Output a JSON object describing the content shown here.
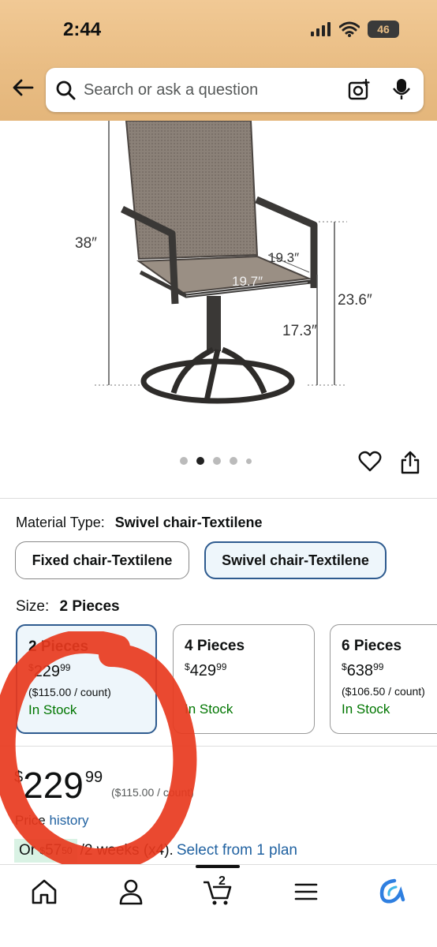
{
  "status_bar": {
    "time": "2:44",
    "battery": "46"
  },
  "search": {
    "placeholder": "Search or ask a question"
  },
  "product_image": {
    "dimensions": [
      "38″",
      "19.3″",
      "19.7″",
      "23.6″",
      "17.3″"
    ],
    "carousel_total": 5,
    "carousel_active": 2
  },
  "material": {
    "label": "Material Type:",
    "selected": "Swivel chair-Textilene",
    "options": [
      "Fixed chair-Textilene",
      "Swivel chair-Textilene"
    ]
  },
  "size": {
    "label": "Size:",
    "selected": "2 Pieces",
    "options": [
      {
        "name": "2 Pieces",
        "price_symbol": "$",
        "price_whole": "229",
        "price_fraction": "99",
        "per_count": "($115.00 / count)",
        "stock": "In Stock"
      },
      {
        "name": "4 Pieces",
        "price_symbol": "$",
        "price_whole": "429",
        "price_fraction": "99",
        "per_count": "",
        "stock": "In Stock"
      },
      {
        "name": "6 Pieces",
        "price_symbol": "$",
        "price_whole": "638",
        "price_fraction": "99",
        "per_count": "($106.50 / count)",
        "stock": "In Stock"
      }
    ]
  },
  "price": {
    "symbol": "$",
    "whole": "229",
    "fraction": "99",
    "per_count": "($115.00 / count)",
    "history_prefix": "Price",
    "history_link": "history"
  },
  "installment": {
    "prefix": "Or",
    "symbol": "$",
    "whole": "57",
    "fraction": "50",
    "terms": "/2 weeks (x4).",
    "link": "Select from 1 plan"
  },
  "bottom_nav": {
    "cart_count": "2"
  },
  "colors": {
    "header": "#e9bd84",
    "selected_border": "#2e5b8f",
    "link": "#2162a1",
    "stock": "#007600",
    "annotation": "#e8391e"
  }
}
